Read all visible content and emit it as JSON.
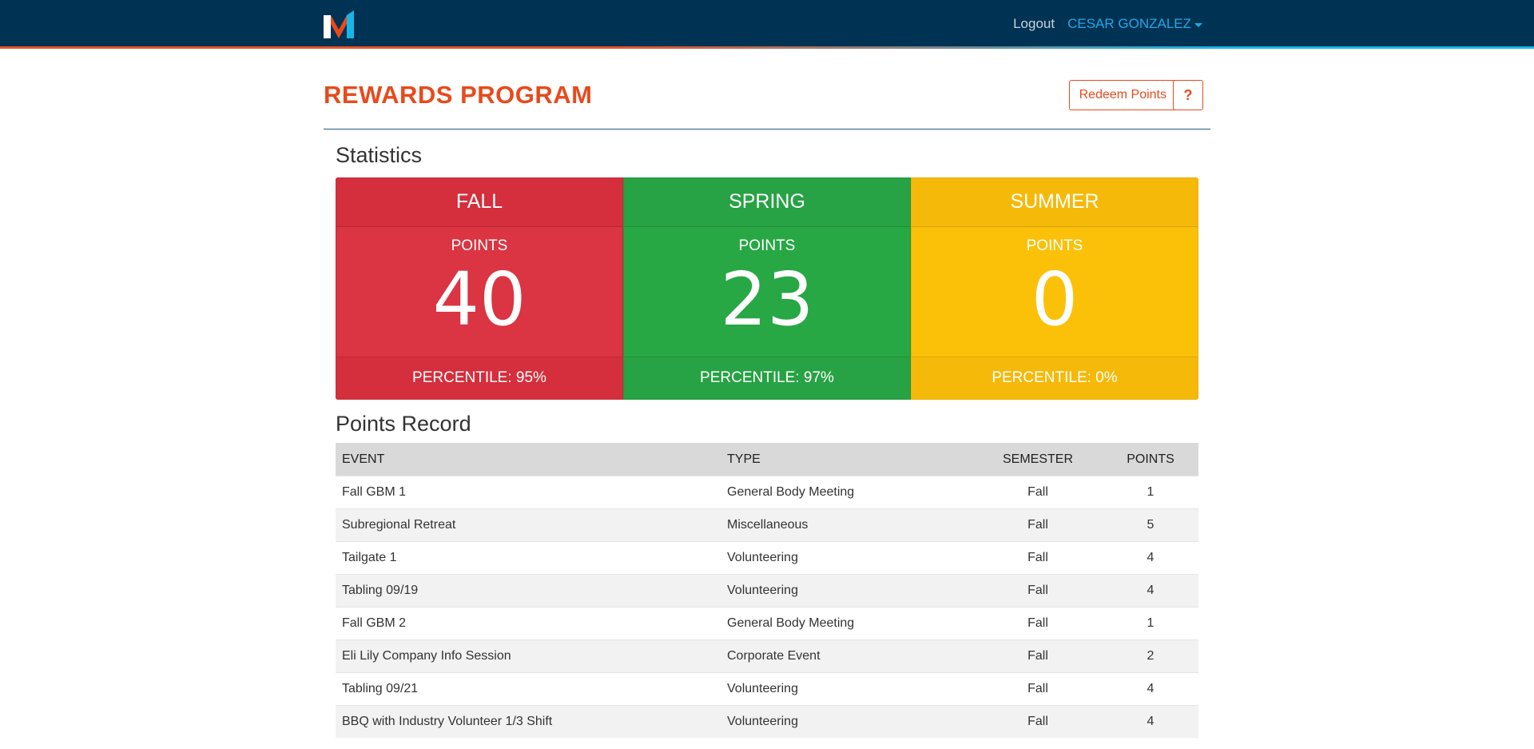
{
  "nav": {
    "logout": "Logout",
    "user": "CESAR GONZALEZ"
  },
  "header": {
    "title": "REWARDS PROGRAM",
    "redeem": "Redeem Points",
    "help": "?"
  },
  "statistics": {
    "title": "Statistics",
    "cards": [
      {
        "season": "FALL",
        "points_label": "POINTS",
        "points": "40",
        "percentile": "PERCENTILE: 95%"
      },
      {
        "season": "SPRING",
        "points_label": "POINTS",
        "points": "23",
        "percentile": "PERCENTILE: 97%"
      },
      {
        "season": "SUMMER",
        "points_label": "POINTS",
        "points": "0",
        "percentile": "PERCENTILE: 0%"
      }
    ]
  },
  "record": {
    "title": "Points Record",
    "columns": [
      "EVENT",
      "TYPE",
      "SEMESTER",
      "POINTS"
    ],
    "rows": [
      [
        "Fall GBM 1",
        "General Body Meeting",
        "Fall",
        "1"
      ],
      [
        "Subregional Retreat",
        "Miscellaneous",
        "Fall",
        "5"
      ],
      [
        "Tailgate 1",
        "Volunteering",
        "Fall",
        "4"
      ],
      [
        "Tabling 09/19",
        "Volunteering",
        "Fall",
        "4"
      ],
      [
        "Fall GBM 2",
        "General Body Meeting",
        "Fall",
        "1"
      ],
      [
        "Eli Lily Company Info Session",
        "Corporate Event",
        "Fall",
        "2"
      ],
      [
        "Tabling 09/21",
        "Volunteering",
        "Fall",
        "4"
      ],
      [
        "BBQ with Industry Volunteer 1/3 Shift",
        "Volunteering",
        "Fall",
        "4"
      ]
    ]
  },
  "colors": {
    "navbar": "#003253",
    "accent": "#e84a1c",
    "fall": "#db3442",
    "spring": "#28a745",
    "summer": "#fbc109"
  }
}
